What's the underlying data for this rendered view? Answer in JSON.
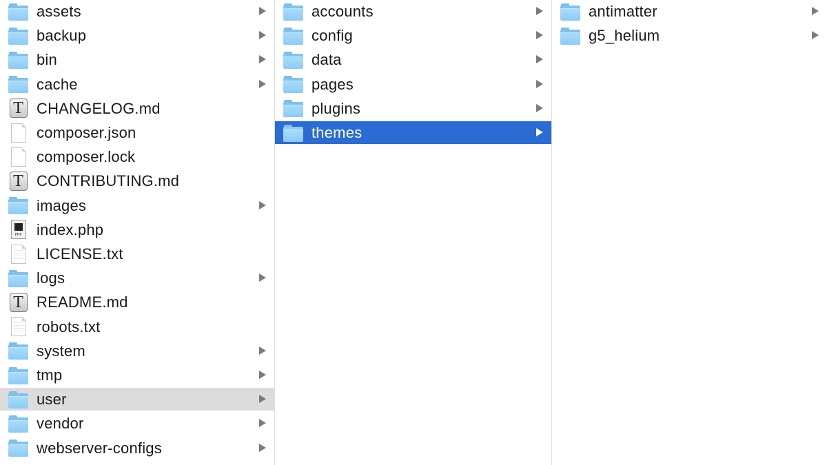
{
  "columns": [
    {
      "items": [
        {
          "label": "assets",
          "type": "folder",
          "state": ""
        },
        {
          "label": "backup",
          "type": "folder",
          "state": ""
        },
        {
          "label": "bin",
          "type": "folder",
          "state": ""
        },
        {
          "label": "cache",
          "type": "folder",
          "state": ""
        },
        {
          "label": "CHANGELOG.md",
          "type": "textdoc",
          "state": ""
        },
        {
          "label": "composer.json",
          "type": "doc",
          "state": ""
        },
        {
          "label": "composer.lock",
          "type": "doc",
          "state": ""
        },
        {
          "label": "CONTRIBUTING.md",
          "type": "textdoc",
          "state": ""
        },
        {
          "label": "images",
          "type": "folder",
          "state": ""
        },
        {
          "label": "index.php",
          "type": "phpdoc",
          "state": ""
        },
        {
          "label": "LICENSE.txt",
          "type": "lineddoc",
          "state": ""
        },
        {
          "label": "logs",
          "type": "folder",
          "state": ""
        },
        {
          "label": "README.md",
          "type": "textdoc",
          "state": ""
        },
        {
          "label": "robots.txt",
          "type": "lineddoc",
          "state": ""
        },
        {
          "label": "system",
          "type": "folder",
          "state": ""
        },
        {
          "label": "tmp",
          "type": "folder",
          "state": ""
        },
        {
          "label": "user",
          "type": "folder",
          "state": "inactive-selected"
        },
        {
          "label": "vendor",
          "type": "folder",
          "state": ""
        },
        {
          "label": "webserver-configs",
          "type": "folder",
          "state": ""
        }
      ]
    },
    {
      "items": [
        {
          "label": "accounts",
          "type": "folder",
          "state": ""
        },
        {
          "label": "config",
          "type": "folder",
          "state": ""
        },
        {
          "label": "data",
          "type": "folder",
          "state": ""
        },
        {
          "label": "pages",
          "type": "folder",
          "state": ""
        },
        {
          "label": "plugins",
          "type": "folder",
          "state": ""
        },
        {
          "label": "themes",
          "type": "folder",
          "state": "selected"
        }
      ]
    },
    {
      "items": [
        {
          "label": "antimatter",
          "type": "folder",
          "state": ""
        },
        {
          "label": "g5_helium",
          "type": "folder",
          "state": ""
        }
      ]
    }
  ],
  "icons": {
    "folder": "folder-icon",
    "textdoc": "text-document-icon",
    "doc": "document-icon",
    "lineddoc": "text-file-icon",
    "phpdoc": "php-file-icon"
  },
  "php_tag": "PHP",
  "text_glyph": "T",
  "colors": {
    "selection": "#2a6bd4",
    "inactive_selection": "#dcdcdc",
    "folder": "#8ccbf5"
  }
}
